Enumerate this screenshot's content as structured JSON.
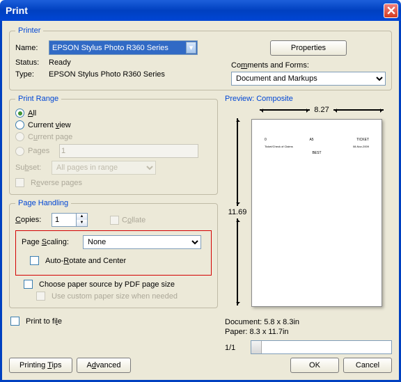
{
  "title": "Print",
  "printer": {
    "legend": "Printer",
    "name_label": "Name:",
    "name_value": "EPSON Stylus Photo R360 Series",
    "status_label": "Status:",
    "status_value": "Ready",
    "type_label": "Type:",
    "type_value": "EPSON Stylus Photo R360 Series",
    "properties_button": "Properties",
    "comments_label": "Comments and Forms:",
    "comments_value": "Document and Markups"
  },
  "range": {
    "legend": "Print Range",
    "all": "All",
    "current_view": "Current view",
    "current_page": "Current page",
    "pages": "Pages",
    "pages_value": "1",
    "subset_label": "Subset:",
    "subset_value": "All pages in range",
    "reverse": "Reverse pages"
  },
  "handling": {
    "legend": "Page Handling",
    "copies_label": "Copies:",
    "copies_value": "1",
    "collate": "Collate",
    "scaling_label": "Page Scaling:",
    "scaling_value": "None",
    "auto_rotate": "Auto-Rotate and Center",
    "choose_source": "Choose paper source by PDF page size",
    "custom_paper": "Use custom paper size when needed"
  },
  "print_to_file": "Print to file",
  "preview": {
    "header": "Preview: Composite",
    "width": "8.27",
    "height": "11.69",
    "doc_size": "Document: 5.8 x 8.3in",
    "paper_size": "Paper: 8.3 x 11.7in",
    "page_num": "1/1"
  },
  "footer": {
    "tips": "Printing Tips",
    "advanced": "Advanced",
    "ok": "OK",
    "cancel": "Cancel"
  }
}
